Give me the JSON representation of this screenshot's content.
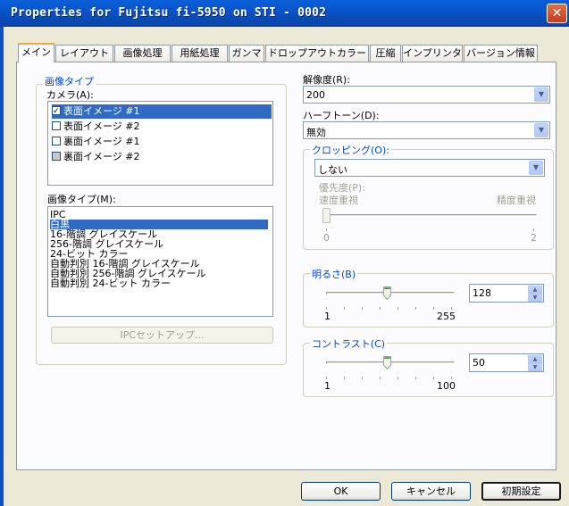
{
  "window": {
    "title": "Properties for Fujitsu fi-5950 on STI - 0002"
  },
  "tabs": [
    "メイン",
    "レイアウト",
    "画像処理",
    "用紙処理",
    "ガンマ",
    "ドロップアウトカラー",
    "圧縮",
    "インプリンタ",
    "バージョン情報"
  ],
  "image_type_group": {
    "title": "画像タイプ",
    "camera_label": "カメラ(A):",
    "cameras": [
      {
        "label": "表面イメージ #1",
        "checked": true,
        "selected": true
      },
      {
        "label": "表面イメージ #2",
        "checked": false,
        "selected": false
      },
      {
        "label": "裏面イメージ #1",
        "checked": false,
        "selected": false
      },
      {
        "label": "裏面イメージ #2",
        "checked": false,
        "selected": false,
        "gray": true
      }
    ],
    "type_label": "画像タイプ(M):",
    "types": [
      "IPC",
      "白黒",
      "16-階調 グレイスケール",
      "256-階調 グレイスケール",
      "24-ビット カラー",
      "自動判別 16-階調 グレイスケール",
      "自動判別 256-階調 グレイスケール",
      "自動判別 24-ビット カラー"
    ],
    "selected_type": "白黒",
    "ipc_button": "IPCセットアップ..."
  },
  "resolution": {
    "label": "解像度(R):",
    "value": "200"
  },
  "halftone": {
    "label": "ハーフトーン(D):",
    "value": "無効"
  },
  "cropping": {
    "title": "クロッピング(O):",
    "value": "しない",
    "priority_label": "優先度(P):",
    "speed_label": "速度重視",
    "precision_label": "精度重視",
    "min": "0",
    "max": "2",
    "level": 0
  },
  "brightness": {
    "title": "明るさ(B)",
    "value": "128",
    "min": "1",
    "max": "255"
  },
  "contrast": {
    "title": "コントラスト(C)",
    "value": "50",
    "min": "1",
    "max": "100"
  },
  "buttons": {
    "ok": "OK",
    "cancel": "キャンセル",
    "defaults": "初期設定"
  }
}
